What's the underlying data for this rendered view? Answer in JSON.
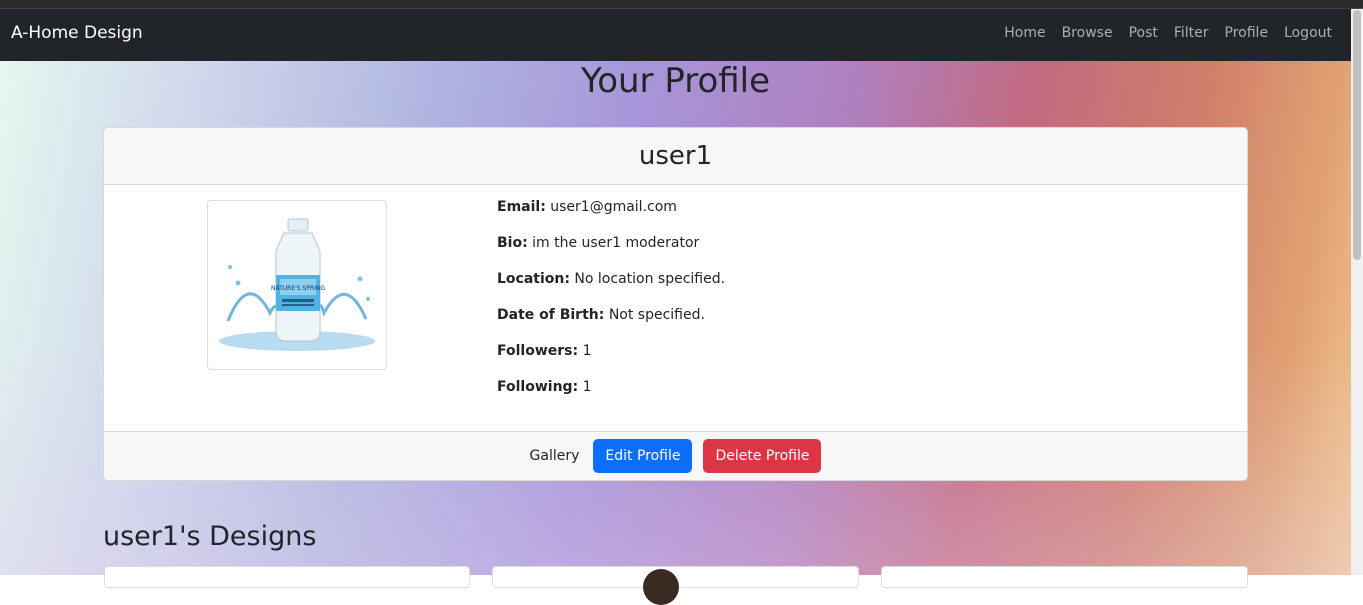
{
  "navbar": {
    "brand": "A-Home Design",
    "links": [
      "Home",
      "Browse",
      "Post",
      "Filter",
      "Profile",
      "Logout"
    ]
  },
  "page": {
    "title": "Your Profile"
  },
  "profile": {
    "username": "user1",
    "avatar_icon": "water-bottle-image",
    "avatar_label": "NATURE'S SPRING",
    "fields": [
      {
        "label": "Email:",
        "value": "user1@gmail.com"
      },
      {
        "label": "Bio:",
        "value": "im the user1 moderator"
      },
      {
        "label": "Location:",
        "value": "No location specified."
      },
      {
        "label": "Date of Birth:",
        "value": "Not specified."
      },
      {
        "label": "Followers:",
        "value": "1"
      },
      {
        "label": "Following:",
        "value": "1"
      }
    ],
    "actions": {
      "gallery": "Gallery",
      "edit": "Edit Profile",
      "delete": "Delete Profile"
    }
  },
  "designs": {
    "title": "user1's Designs"
  },
  "colors": {
    "navbar": "#212529",
    "primary": "#0d6efd",
    "danger": "#dc3545"
  }
}
